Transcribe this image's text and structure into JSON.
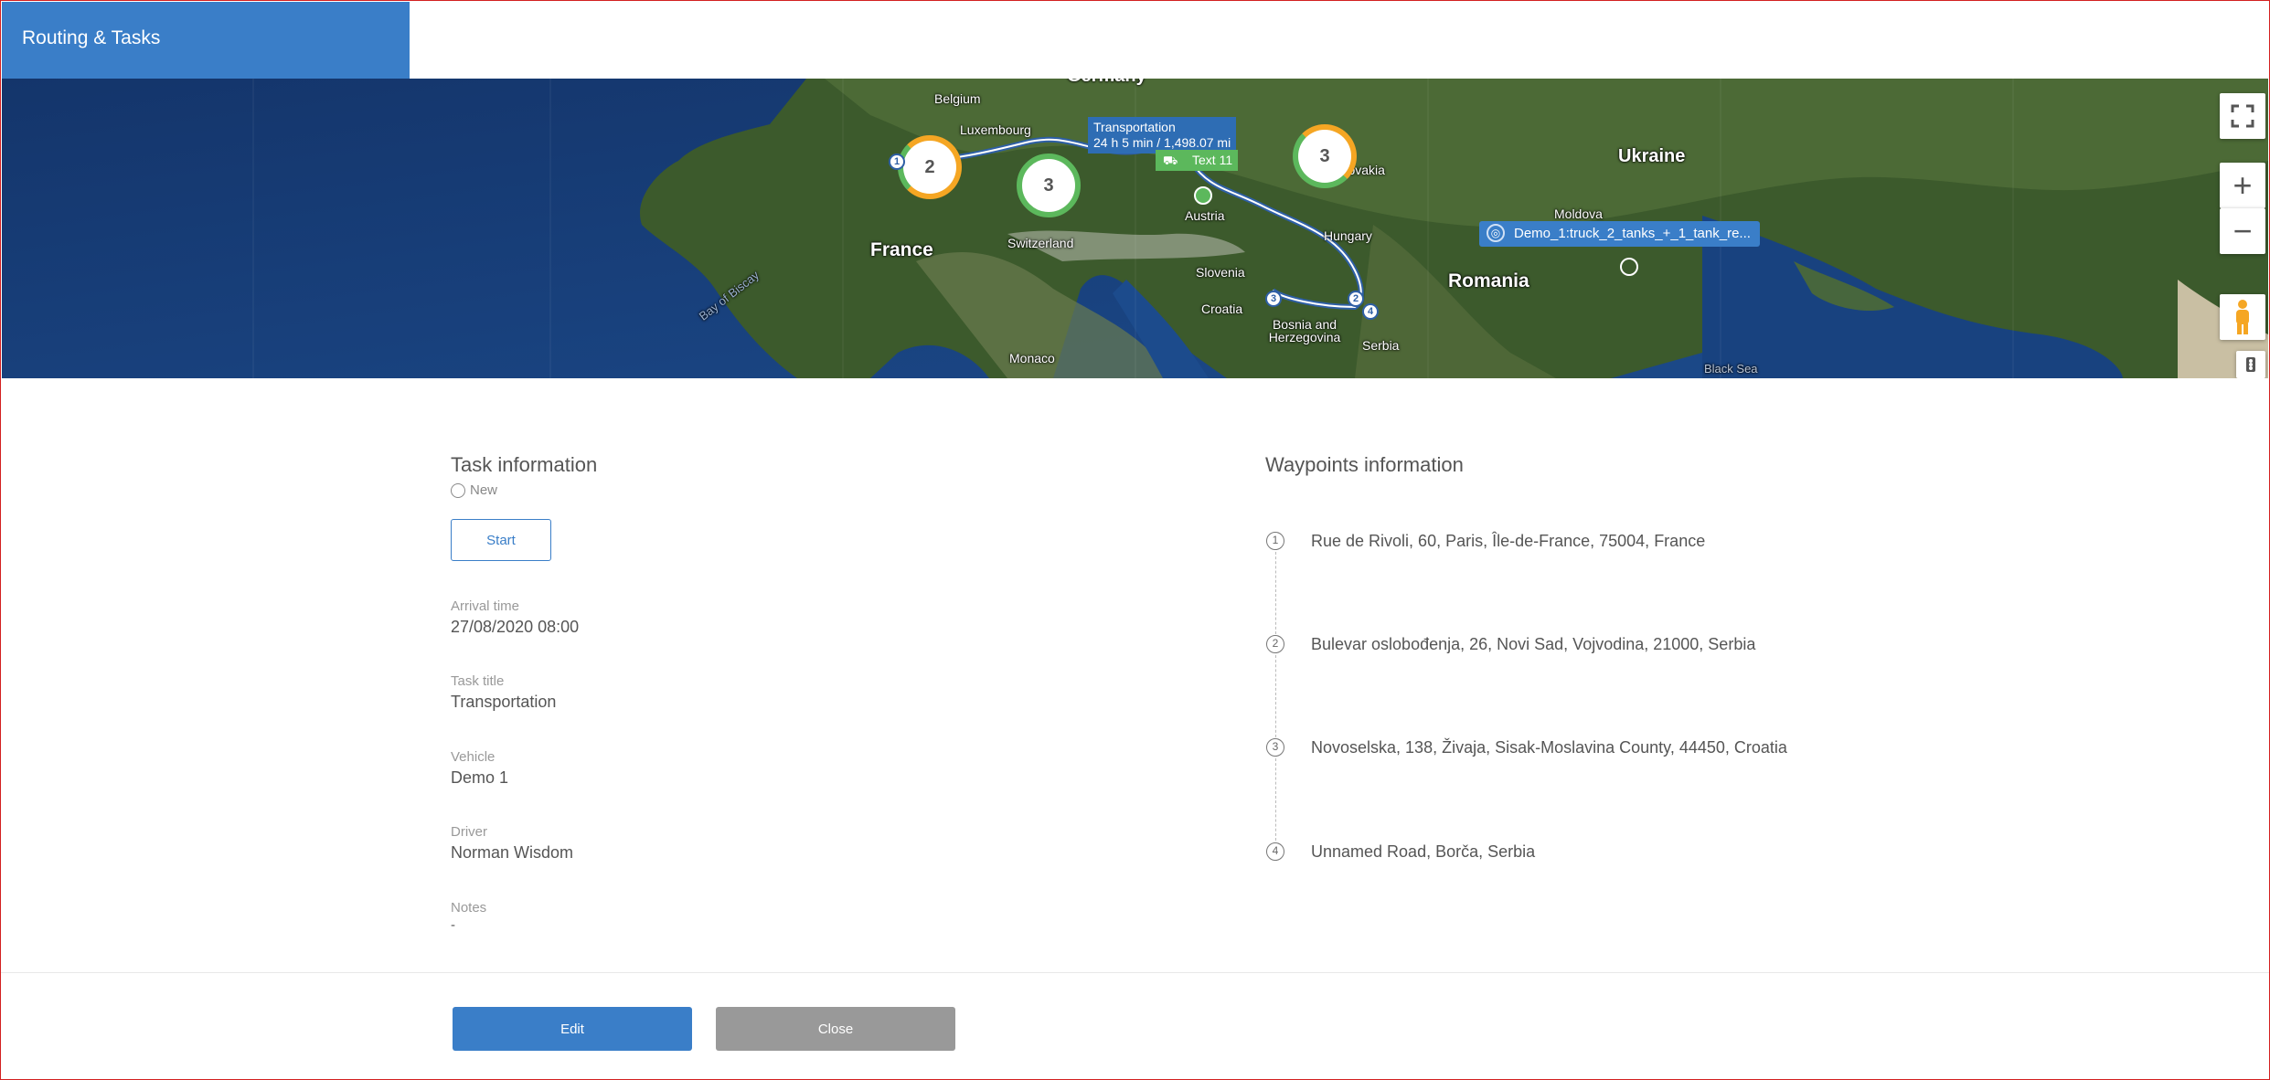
{
  "app": {
    "title": "Routing & Tasks"
  },
  "map": {
    "countries": [
      "Germany",
      "Belgium",
      "Luxembourg",
      "France",
      "Switzerland",
      "Austria",
      "Slovakia",
      "Hungary",
      "Slovenia",
      "Croatia",
      "Bosnia and Herzegovina",
      "Serbia",
      "Monaco",
      "Romania",
      "Moldova",
      "Ukraine"
    ],
    "water": [
      "Bay of Biscay",
      "Black Sea"
    ],
    "clusters": [
      "2",
      "3",
      "3"
    ],
    "route_tooltip": {
      "title": "Transportation",
      "detail": "24 h 5 min / 1,498.07 mi"
    },
    "task_marker_label": "Text 11",
    "vehicle_label": "Demo_1:truck_2_tanks_+_1_tank_re...",
    "waypoint_markers": [
      "1",
      "2",
      "3",
      "4"
    ],
    "controls": {
      "fullscreen_icon": "fullscreen-icon",
      "zoom_in": "+",
      "zoom_out": "−",
      "pegman_icon": "pegman-icon",
      "traffic_icon": "traffic-light-icon"
    },
    "colors": {
      "route": "#2e5fa5",
      "cluster_green": "#5cb85c",
      "cluster_orange": "#f5a623",
      "accent": "#3a7ec8"
    }
  },
  "task": {
    "section_title": "Task information",
    "status": "New",
    "start_label": "Start",
    "fields": [
      {
        "label": "Arrival time",
        "value": "27/08/2020 08:00"
      },
      {
        "label": "Task title",
        "value": "Transportation"
      },
      {
        "label": "Vehicle",
        "value": "Demo 1"
      },
      {
        "label": "Driver",
        "value": "Norman Wisdom"
      },
      {
        "label": "Notes",
        "value": "-"
      }
    ]
  },
  "waypoints": {
    "section_title": "Waypoints information",
    "items": [
      {
        "num": "1",
        "address": "Rue de Rivoli, 60, Paris, Île-de-France, 75004, France"
      },
      {
        "num": "2",
        "address": "Bulevar oslobođenja, 26, Novi Sad, Vojvodina, 21000, Serbia"
      },
      {
        "num": "3",
        "address": "Novoselska, 138, Živaja, Sisak-Moslavina County, 44450, Croatia"
      },
      {
        "num": "4",
        "address": "Unnamed Road, Borča, Serbia"
      }
    ]
  },
  "footer": {
    "edit_label": "Edit",
    "close_label": "Close"
  }
}
